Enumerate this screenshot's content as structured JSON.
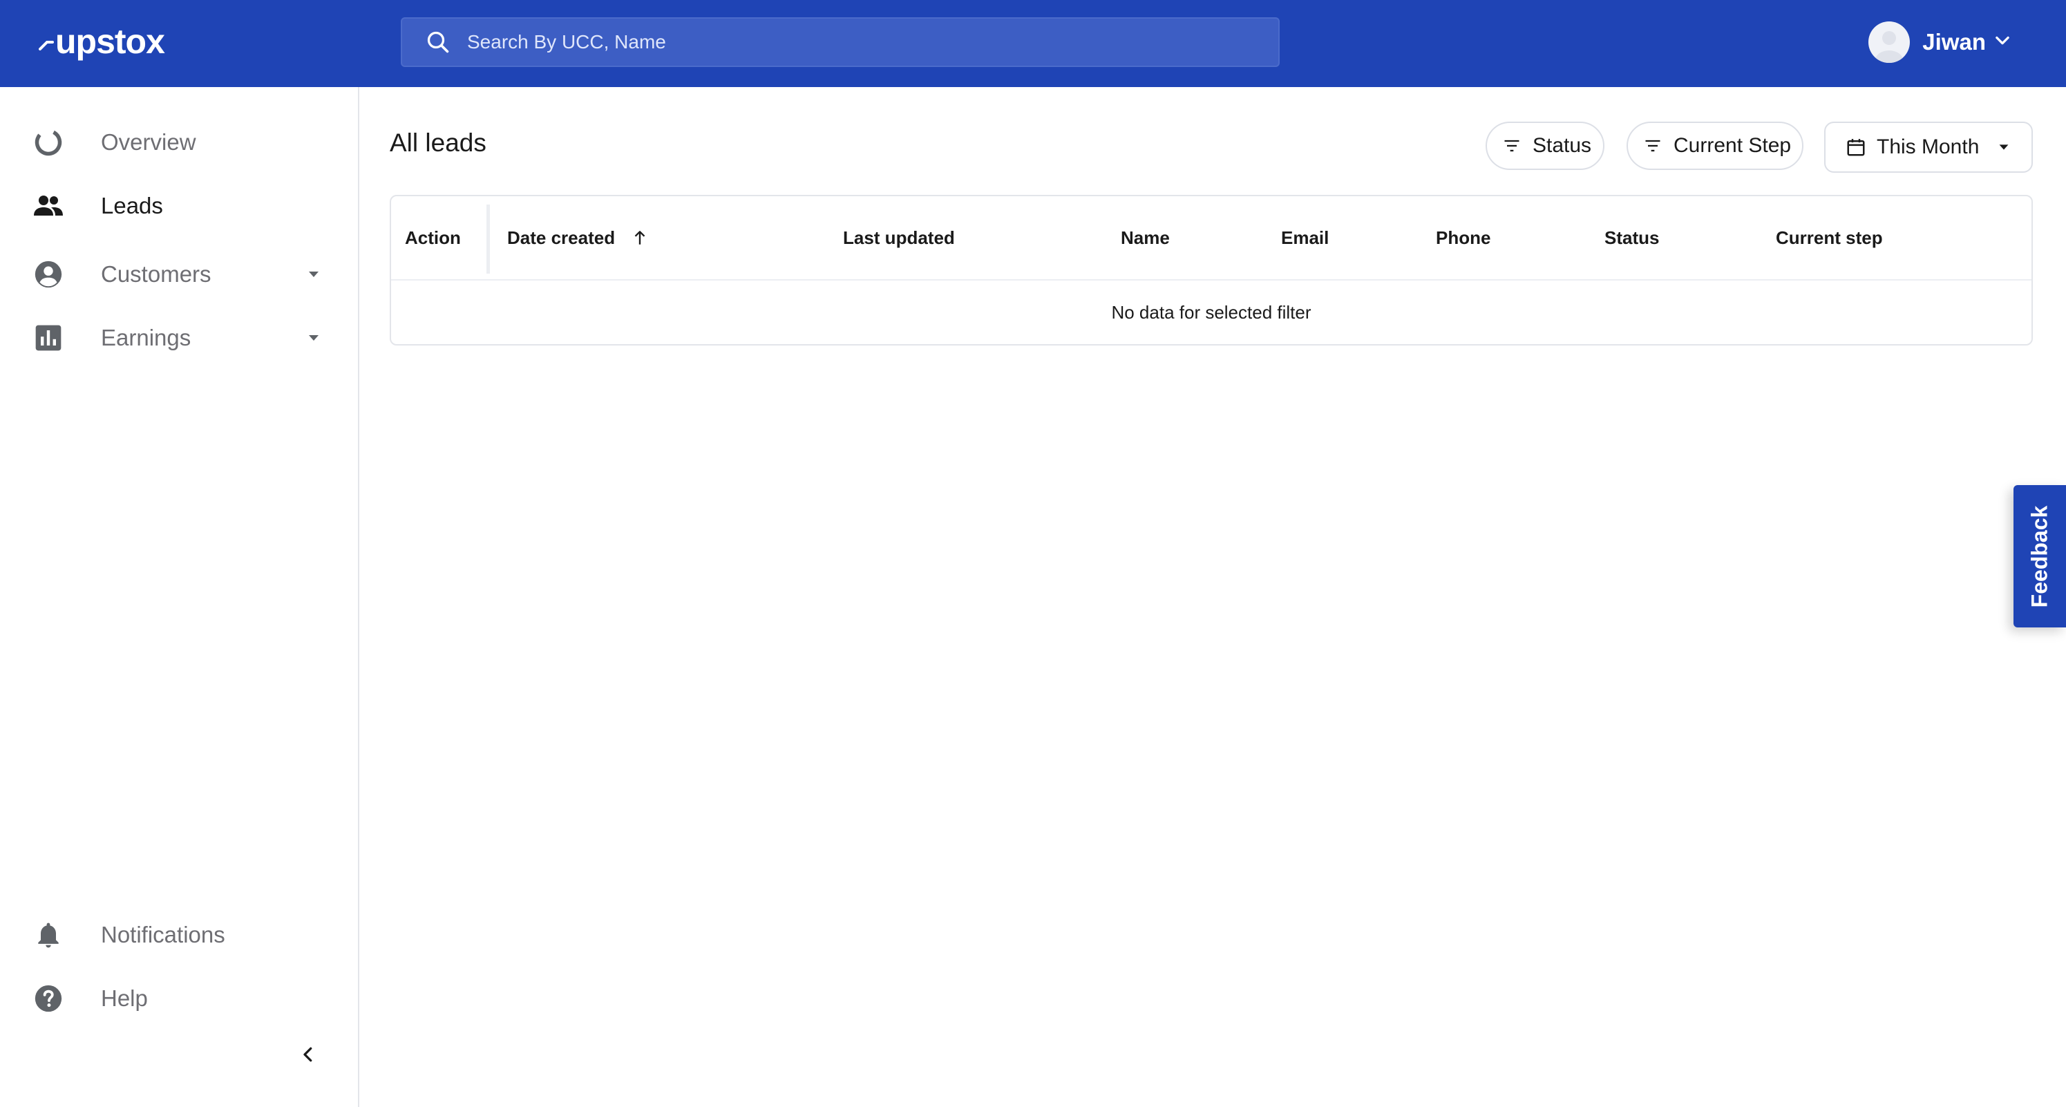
{
  "header": {
    "logo_text": "upstox",
    "search": {
      "placeholder": "Search By UCC, Name",
      "value": ""
    },
    "user": {
      "name": "Jiwan"
    }
  },
  "sidebar": {
    "items": [
      {
        "label": "Overview",
        "icon": "overview-ring-icon"
      },
      {
        "label": "Leads",
        "icon": "people-icon",
        "active": true
      },
      {
        "label": "Customers",
        "icon": "account-circle-icon",
        "has_submenu": true
      },
      {
        "label": "Earnings",
        "icon": "bar-chart-icon",
        "has_submenu": true
      }
    ],
    "bottom_items": [
      {
        "label": "Notifications",
        "icon": "bell-icon"
      },
      {
        "label": "Help",
        "icon": "help-circle-icon"
      }
    ]
  },
  "main": {
    "title": "All leads",
    "filters": {
      "status_label": "Status",
      "current_step_label": "Current Step",
      "date_range_label": "This Month"
    },
    "table": {
      "columns": [
        "Action",
        "Date created",
        "Last updated",
        "Name",
        "Email",
        "Phone",
        "Status",
        "Current step"
      ],
      "empty_message": "No data for selected filter"
    }
  },
  "feedback_label": "Feedback",
  "colors": {
    "brand_blue": "#1f44b5",
    "search_bg": "#3d5ec4",
    "muted_text": "#6e6e73"
  }
}
